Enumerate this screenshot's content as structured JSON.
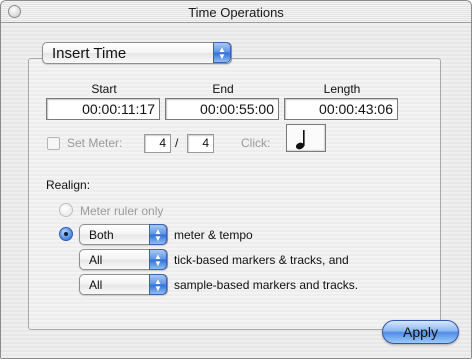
{
  "window": {
    "title": "Time Operations"
  },
  "mode_popup": {
    "value": "Insert Time"
  },
  "columns": {
    "start_label": "Start",
    "end_label": "End",
    "length_label": "Length"
  },
  "fields": {
    "start": "00:00:11:17",
    "end": "00:00:55:00",
    "length": "00:00:43:06"
  },
  "meter": {
    "checkbox_label": "Set Meter:",
    "checked": false,
    "numerator": "4",
    "separator": "/",
    "denominator": "4",
    "click_label": "Click:",
    "click_icon": "quarter-note-icon",
    "click_glyph": "♩"
  },
  "realign": {
    "heading": "Realign:",
    "meter_ruler_only_label": "Meter ruler only",
    "meter_ruler_only_selected": false,
    "meter_tempo_selected": true,
    "meter_tempo_popup": "Both",
    "meter_tempo_label": "meter & tempo",
    "tick_popup": "All",
    "tick_label": "tick-based markers & tracks, and",
    "sample_popup": "All",
    "sample_label": "sample-based markers and tracks."
  },
  "buttons": {
    "apply": "Apply"
  },
  "colors": {
    "accent": "#3a7be0",
    "dimmed_text": "#9a9a9a"
  }
}
